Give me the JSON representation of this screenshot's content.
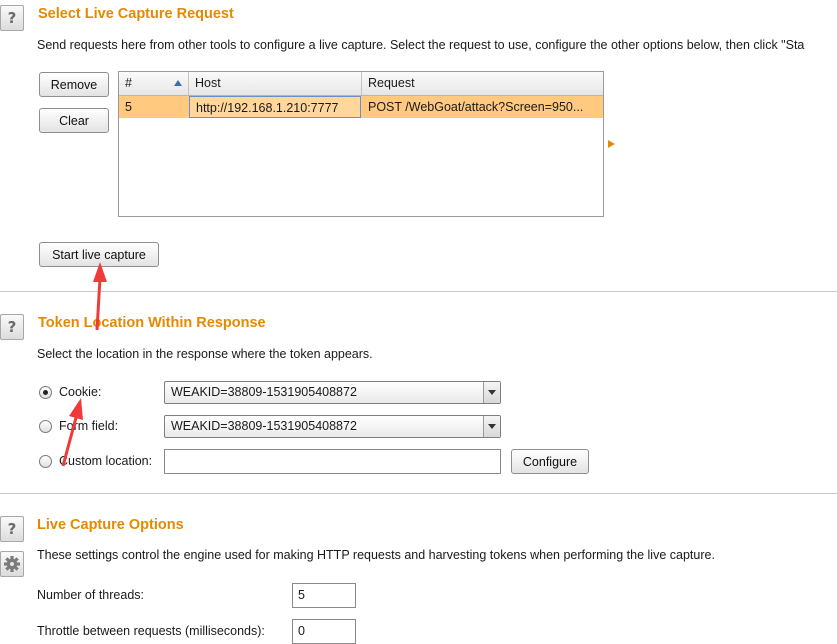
{
  "capture_section": {
    "title": "Select Live Capture Request",
    "description": "Send requests here from other tools to configure a live capture. Select the request to use, configure the other options below, then click \"Sta",
    "remove_label": "Remove",
    "clear_label": "Clear",
    "start_label": "Start live capture",
    "table": {
      "headers": [
        "#",
        "Host",
        "Request"
      ],
      "rows": [
        {
          "num": "5",
          "host": "http://192.168.1.210:7777",
          "request": "POST /WebGoat/attack?Screen=950..."
        }
      ]
    }
  },
  "token_section": {
    "title": "Token Location Within Response",
    "description": "Select the location in the response where the token appears.",
    "cookie_label": "Cookie:",
    "cookie_value": "WEAKID=38809-1531905408872",
    "form_label": "Form field:",
    "form_value": "WEAKID=38809-1531905408872",
    "custom_label": "Custom location:",
    "custom_value": "",
    "configure_label": "Configure",
    "selected": "cookie"
  },
  "options_section": {
    "title": "Live Capture Options",
    "description": "These settings control the engine used for making HTTP requests and harvesting tokens when performing the live capture.",
    "threads_label": "Number of threads:",
    "threads_value": "5",
    "throttle_label": "Throttle between requests (milliseconds):",
    "throttle_value": "0"
  },
  "icons": {
    "help": "question-mark-icon",
    "settings": "gear-icon",
    "sort": "sort-ascending-icon",
    "expand": "triangle-right-icon"
  },
  "colors": {
    "accent": "#e58900",
    "selection": "#ffc97f",
    "annotation": "#f03a3a"
  }
}
